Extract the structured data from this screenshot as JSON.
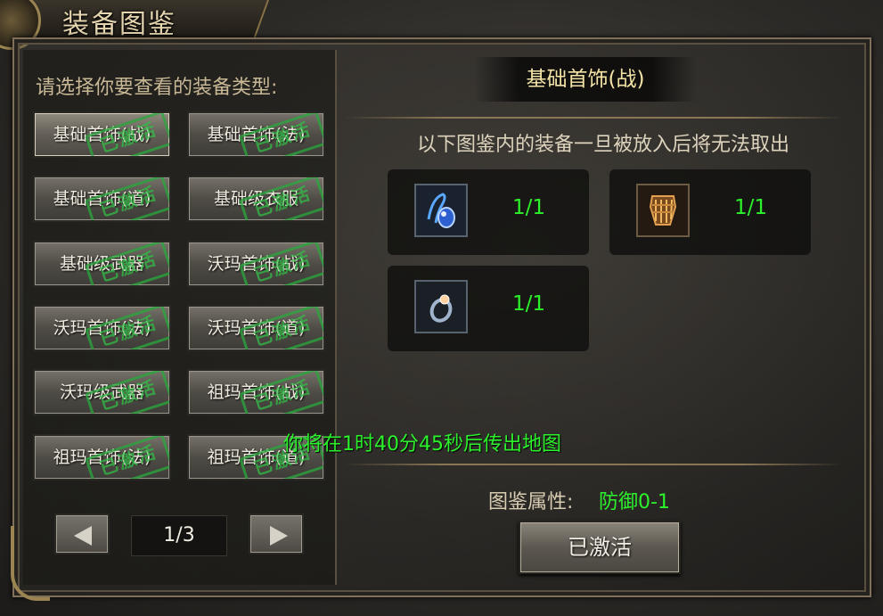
{
  "window": {
    "title": "装备图鉴"
  },
  "left": {
    "prompt": "请选择你要查看的装备类型:",
    "stamp_text": "已激活",
    "buttons": [
      {
        "label": "基础首饰(战)",
        "selected": true
      },
      {
        "label": "基础首饰(法)"
      },
      {
        "label": "基础首饰(道)"
      },
      {
        "label": "基础级衣服"
      },
      {
        "label": "基础级武器"
      },
      {
        "label": "沃玛首饰(战)"
      },
      {
        "label": "沃玛首饰(法)"
      },
      {
        "label": "沃玛首饰(道)"
      },
      {
        "label": "沃玛级武器"
      },
      {
        "label": "祖玛首饰(战)"
      },
      {
        "label": "祖玛首饰(法)"
      },
      {
        "label": "祖玛首饰(道)"
      }
    ],
    "pager": {
      "page": "1/3",
      "prev_icon": "arrow-left-icon",
      "next_icon": "arrow-right-icon"
    }
  },
  "right": {
    "header": "基础首饰(战)",
    "notice": "以下图鉴内的装备一旦被放入后将无法取出",
    "items": [
      {
        "icon": "necklace-icon",
        "count": "1/1"
      },
      {
        "icon": "bracelet-icon",
        "count": "1/1"
      },
      {
        "icon": "ring-icon",
        "count": "1/1"
      }
    ],
    "teleport_message": "你将在1时40分45秒后传出地图",
    "attribute_label": "图鉴属性:",
    "attribute_value": "防御0-1",
    "activate_button": "已激活"
  },
  "colors": {
    "green_text": "#2cf22c",
    "gold_header": "#f4e4a6",
    "stamp_green": "#32be46"
  }
}
